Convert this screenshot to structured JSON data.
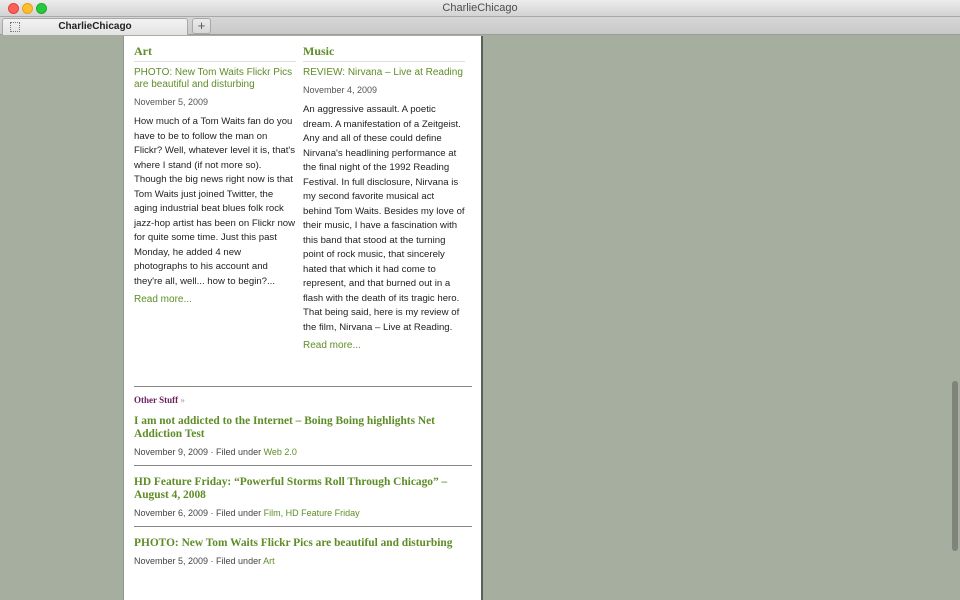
{
  "window": {
    "title": "CharlieChicago"
  },
  "tabs": [
    {
      "label": "CharlieChicago"
    }
  ],
  "new_tab_label": "+",
  "columns": {
    "art": {
      "heading": "Art",
      "post_title": "PHOTO: New Tom Waits Flickr Pics are beautiful and disturbing",
      "date": "November 5, 2009",
      "excerpt": "How much of a Tom Waits fan do you have to be to follow the man on Flickr? Well, whatever level it is, that's where I stand (if not more so). Though the big news right now is that Tom Waits just joined Twitter, the aging industrial beat blues folk rock jazz-hop artist has been on Flickr now for quite some time. Just this past Monday, he added 4 new photographs to his account and they're all, well... how to begin?...",
      "read_more": "Read more..."
    },
    "music": {
      "heading": "Music",
      "post_title": "REVIEW: Nirvana – Live at Reading",
      "date": "November 4, 2009",
      "excerpt": "An aggressive assault. A poetic dream. A manifestation of a Zeitgeist. Any and all of these could define Nirvana's headlining performance at the final night of the 1992 Reading Festival. In full disclosure, Nirvana is my second favorite musical act behind Tom Waits. Besides my love of their music, I have a fascination with this band that stood at the turning point of rock music, that sincerely hated that which it had come to represent, and that burned out in a flash with the death of its tragic hero. That being said, here is my review of the film, Nirvana – Live at Reading.",
      "read_more": "Read more..."
    }
  },
  "other_stuff": {
    "heading": "Other Stuff",
    "raquo": "»",
    "items": [
      {
        "title": "I am not addicted to the Internet – Boing Boing highlights Net Addiction Test",
        "date": "November 9, 2009",
        "filed_prefix": " · Filed under ",
        "categories": "Web 2.0"
      },
      {
        "title": "HD Feature Friday: “Powerful Storms Roll Through Chicago” – August 4, 2008",
        "date": "November 6, 2009",
        "filed_prefix": " · Filed under ",
        "categories": "Film, HD Feature Friday"
      },
      {
        "title": "PHOTO: New Tom Waits Flickr Pics are beautiful and disturbing",
        "date": "November 5, 2009",
        "filed_prefix": " · Filed under ",
        "categories": "Art"
      }
    ]
  },
  "colors": {
    "link_green": "#5e8d27",
    "other_heading_purple": "#6b1f5f",
    "background": "#a6ae9f"
  }
}
